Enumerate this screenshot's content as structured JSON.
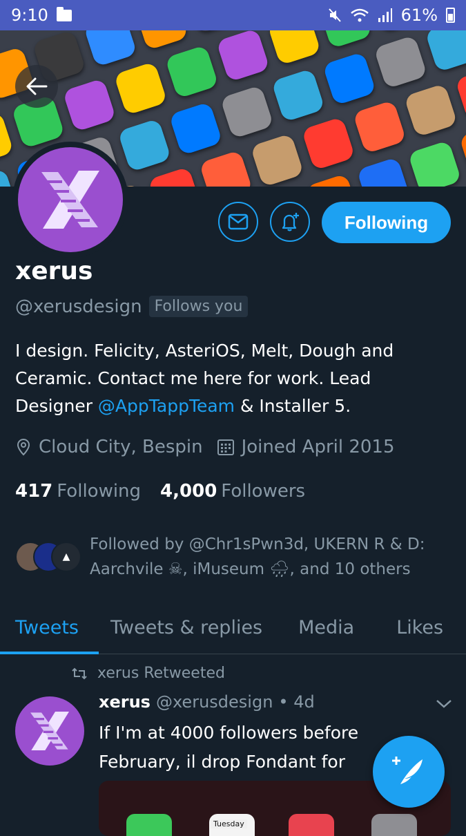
{
  "status_bar": {
    "time": "9:10",
    "battery": "61%",
    "color": "#4a5cc0"
  },
  "profile": {
    "name": "xerus",
    "handle": "@xerusdesign",
    "follows_you": "Follows you",
    "bio_parts": [
      "I design. Felicity, AsteriOS, Melt, Dough and Ceramic. Contact me here for work. Lead Designer ",
      "@AppTappTeam",
      " & Installer 5."
    ],
    "location": "Cloud City, Bespin",
    "joined": "Joined April 2015",
    "following_count": "417",
    "following_label": "Following",
    "followers_count": "4,000",
    "followers_label": "Followers",
    "followed_by": "Followed by @Chr1sPwn3d, UKERN R & D: Aarchvile ☠, iMuseum 🌧, and 10 others",
    "avatar_color": "#9a4fcf"
  },
  "actions": {
    "message_icon": "envelope-icon",
    "notify_icon": "bell-plus-icon",
    "following_label": "Following",
    "accent": "#1da1f2"
  },
  "tabs": [
    "Tweets",
    "Tweets & replies",
    "Media",
    "Likes"
  ],
  "active_tab": "Tweets",
  "tweet": {
    "retweet_label": "xerus Retweeted",
    "name": "xerus",
    "handle": "@xerusdesign",
    "time": "• 4d",
    "text": "If I'm at 4000 followers before\nFebruary, il drop Fondant for",
    "media_label": "Tuesday"
  },
  "fab": {
    "icon": "compose-tweet-icon"
  }
}
